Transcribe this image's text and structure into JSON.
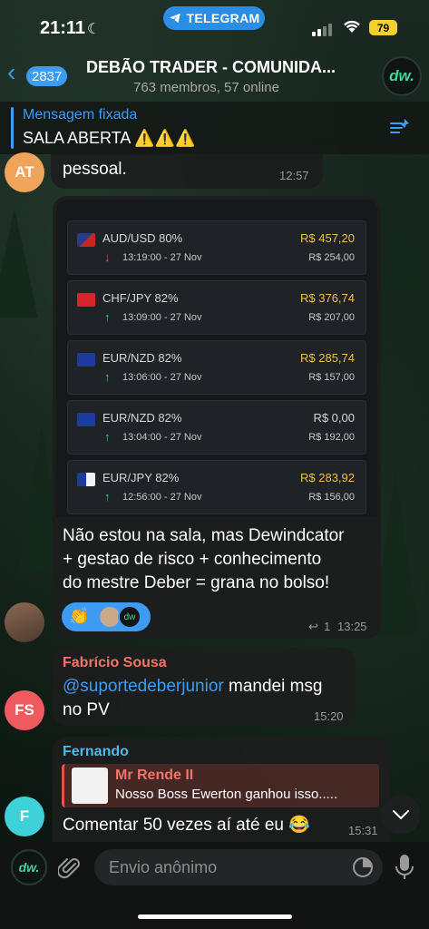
{
  "status_bar": {
    "time": "21:11",
    "pill_label": "TELEGRAM",
    "battery": "79"
  },
  "header": {
    "back_count": "2837",
    "title": "DEBÃO TRADER - COMUNIDA...",
    "subtitle": "763 membros, 57 online",
    "avatar_label": "dw."
  },
  "pinned": {
    "label": "Mensagem fixada",
    "text": "SALA ABERTA ⚠️⚠️⚠️"
  },
  "messages": {
    "m1": {
      "avatar": "AT",
      "text": "pessoal.",
      "time": "12:57"
    },
    "m2": {
      "trades": [
        {
          "pair": "AUD/USD 80%",
          "direction": "down",
          "when": "13:19:00 - 27 Nov",
          "result": "R$ 457,20",
          "stake": "R$ 254,00"
        },
        {
          "pair": "CHF/JPY  82%",
          "direction": "up",
          "when": "13:09:00 - 27 Nov",
          "result": "R$ 376,74",
          "stake": "R$ 207,00"
        },
        {
          "pair": "EUR/NZD 82%",
          "direction": "up",
          "when": "13:06:00 - 27 Nov",
          "result": "R$ 285,74",
          "stake": "R$ 157,00"
        },
        {
          "pair": "EUR/NZD 82%",
          "direction": "up",
          "when": "13:04:00 - 27 Nov",
          "result": "R$ 0,00",
          "stake": "R$ 192,00"
        },
        {
          "pair": "EUR/JPY 82%",
          "direction": "up",
          "when": "12:56:00 - 27 Nov",
          "result": "R$ 283,92",
          "stake": "R$ 156,00"
        }
      ],
      "text_line1": "Não estou na sala, mas Dewindcator",
      "text_line2": "+ gestao de risco + conhecimento",
      "text_line3": "do mestre Deber = grana no bolso!",
      "reaction_emoji": "👏",
      "replies": "1",
      "time": "13:25"
    },
    "m3": {
      "avatar": "FS",
      "sender": "Fabrício Sousa",
      "mention": "@suportedeberjunior",
      "text_a": " mandei msg",
      "text_b": "no PV",
      "time": "15:20"
    },
    "m4": {
      "avatar": "F",
      "sender": "Fernando",
      "quote_author": "Mr Rende II",
      "quote_text": "Nosso Boss Ewerton ganhou isso.....",
      "text": "Comentar 50 vezes aí até eu 😂",
      "time": "15:31"
    }
  },
  "composer": {
    "placeholder": "Envio anônimo",
    "avatar_label": "dw."
  },
  "colors": {
    "accent": "#3e9bf2",
    "gold": "#e8c24a",
    "up": "#3fc77a",
    "down": "#e0564f"
  }
}
